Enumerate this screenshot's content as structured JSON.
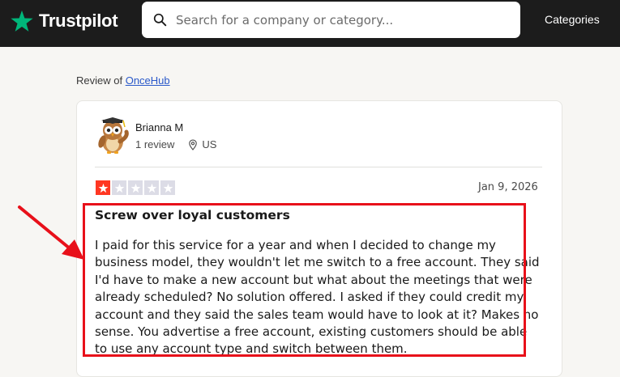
{
  "header": {
    "logo_text": "Trustpilot",
    "search_placeholder": "Search for a company or category...",
    "categories_label": "Categories"
  },
  "review_of": {
    "prefix": "Review of ",
    "company": "OnceHub"
  },
  "reviewer": {
    "name": "Brianna M",
    "review_count": "1 review",
    "country": "US"
  },
  "review": {
    "rating": 1,
    "max_rating": 5,
    "date": "Jan 9, 2026",
    "title": "Screw over loyal customers",
    "body": "I paid for this service for a year and when I decided to change my business model, they wouldn't let me switch to a free account. They said I'd have to make a new account but what about the meetings that were already scheduled? No solution offered. I asked if they could credit my account and they said the sales team would have to look at it? Makes no sense. You advertise a free account, existing customers should be able to use any account type and switch between them."
  },
  "colors": {
    "header_bg": "#1c1c1c",
    "trustpilot_green": "#00b67a",
    "star_red": "#ff3722",
    "star_empty": "#dcdce6",
    "annotation_red": "#e8101a",
    "link_blue": "#2958c9"
  },
  "icons": {
    "logo": "star-icon",
    "search": "search-icon",
    "location": "location-pin-icon",
    "avatar": "owl-avatar"
  }
}
